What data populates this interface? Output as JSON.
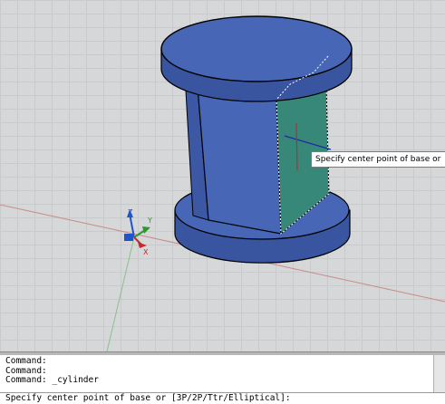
{
  "tooltip": {
    "text": "Specify center point of base or",
    "button_icon": "down-arrow-icon"
  },
  "command_history": [
    "Command:",
    "Command:",
    "Command: _cylinder"
  ],
  "command_prompt": "Specify center point of base or [3P/2P/Ttr/Elliptical]:",
  "ucs_icon": {
    "z_label": "Z",
    "y_label": "Y",
    "x_label": "X"
  },
  "colors": {
    "solid_face": "#4766b6",
    "solid_dark": "#3a55a0",
    "highlight_face": "#38887a",
    "viewport_bg": "#d6d7d8"
  }
}
